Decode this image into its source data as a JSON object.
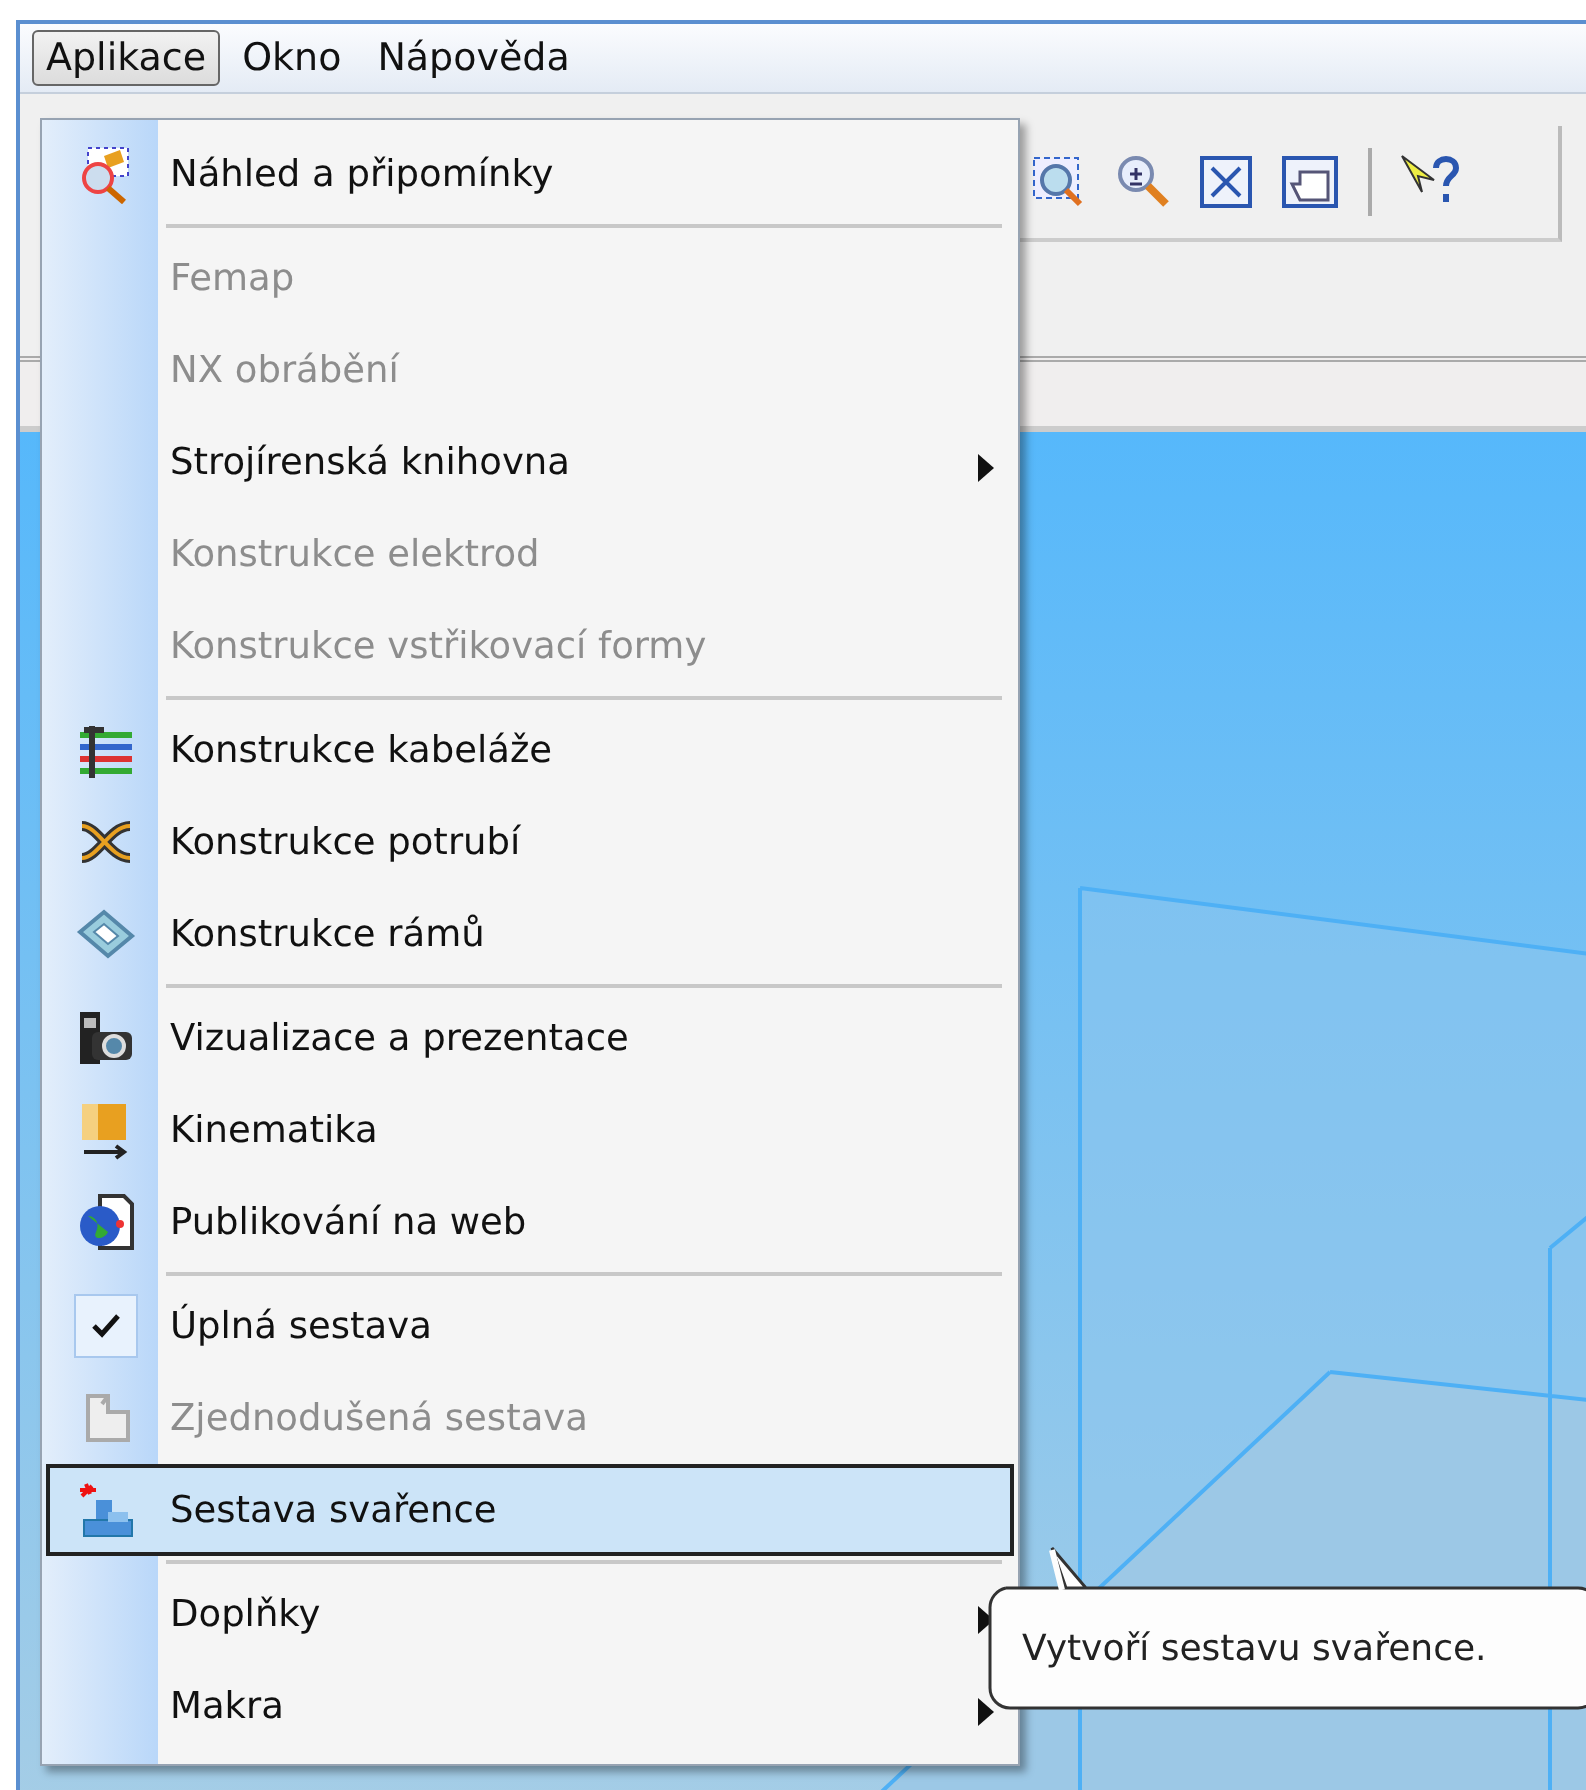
{
  "menu_bar": [
    {
      "label": "Aplikace",
      "selected": true
    },
    {
      "label": "Okno",
      "selected": false
    },
    {
      "label": "Nápověda",
      "selected": false
    }
  ],
  "menu": [
    {
      "kind": "item",
      "label": "Náhled a připomínky",
      "disabled": false,
      "checked": false,
      "submenu": false,
      "selected": false
    },
    {
      "kind": "separator"
    },
    {
      "kind": "item",
      "label": "Femap",
      "disabled": true,
      "checked": false,
      "submenu": false,
      "selected": false
    },
    {
      "kind": "item",
      "label": "NX obrábění",
      "disabled": true,
      "checked": false,
      "submenu": false,
      "selected": false
    },
    {
      "kind": "item",
      "label": "Strojírenská knihovna",
      "disabled": false,
      "checked": false,
      "submenu": true,
      "selected": false
    },
    {
      "kind": "item",
      "label": "Konstrukce elektrod",
      "disabled": true,
      "checked": false,
      "submenu": false,
      "selected": false
    },
    {
      "kind": "item",
      "label": "Konstrukce vstřikovací formy",
      "disabled": true,
      "checked": false,
      "submenu": false,
      "selected": false
    },
    {
      "kind": "separator"
    },
    {
      "kind": "item",
      "label": "Konstrukce kabeláže",
      "disabled": false,
      "checked": false,
      "submenu": false,
      "selected": false
    },
    {
      "kind": "item",
      "label": "Konstrukce potrubí",
      "disabled": false,
      "checked": false,
      "submenu": false,
      "selected": false
    },
    {
      "kind": "item",
      "label": "Konstrukce rámů",
      "disabled": false,
      "checked": false,
      "submenu": false,
      "selected": false
    },
    {
      "kind": "separator"
    },
    {
      "kind": "item",
      "label": "Vizualizace a prezentace",
      "disabled": false,
      "checked": false,
      "submenu": false,
      "selected": false
    },
    {
      "kind": "item",
      "label": "Kinematika",
      "disabled": false,
      "checked": false,
      "submenu": false,
      "selected": false
    },
    {
      "kind": "item",
      "label": "Publikování na web",
      "disabled": false,
      "checked": false,
      "submenu": false,
      "selected": false
    },
    {
      "kind": "separator"
    },
    {
      "kind": "item",
      "label": "Úplná sestava",
      "disabled": false,
      "checked": true,
      "submenu": false,
      "selected": false
    },
    {
      "kind": "item",
      "label": "Zjednodušená sestava",
      "disabled": true,
      "checked": false,
      "submenu": false,
      "selected": false
    },
    {
      "kind": "item",
      "label": "Sestava svařence",
      "disabled": false,
      "checked": false,
      "submenu": false,
      "selected": true
    },
    {
      "kind": "separator"
    },
    {
      "kind": "item",
      "label": "Doplňky",
      "disabled": false,
      "checked": false,
      "submenu": true,
      "selected": false
    },
    {
      "kind": "item",
      "label": "Makra",
      "disabled": false,
      "checked": false,
      "submenu": true,
      "selected": false
    }
  ],
  "tooltip": {
    "text": "Vytvoří sestavu svařence."
  }
}
